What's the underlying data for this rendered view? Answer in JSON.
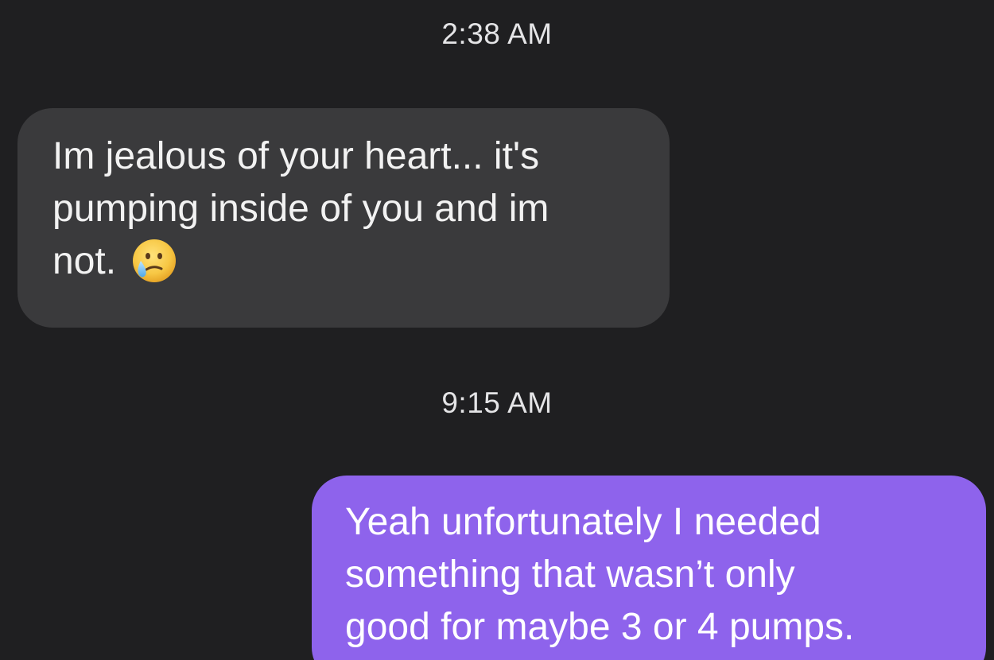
{
  "conversation": {
    "timestamps": [
      "2:38 AM",
      "9:15 AM"
    ],
    "messages": [
      {
        "direction": "incoming",
        "lines": [
          "Im jealous of your heart... it's",
          "pumping inside of you and im",
          "not."
        ],
        "emoji": "face-holding-back-tears-icon",
        "bubble_color": "#3a3a3c"
      },
      {
        "direction": "outgoing",
        "lines": [
          "Yeah unfortunately I needed",
          "something that wasn’t only",
          "good for maybe 3 or 4 pumps."
        ],
        "bubble_color": "#8e63ec"
      }
    ]
  },
  "colors": {
    "background": "#1f1f21",
    "incoming_bubble": "#3a3a3c",
    "outgoing_bubble": "#8e63ec",
    "timestamp_text": "#e4e4e6"
  }
}
